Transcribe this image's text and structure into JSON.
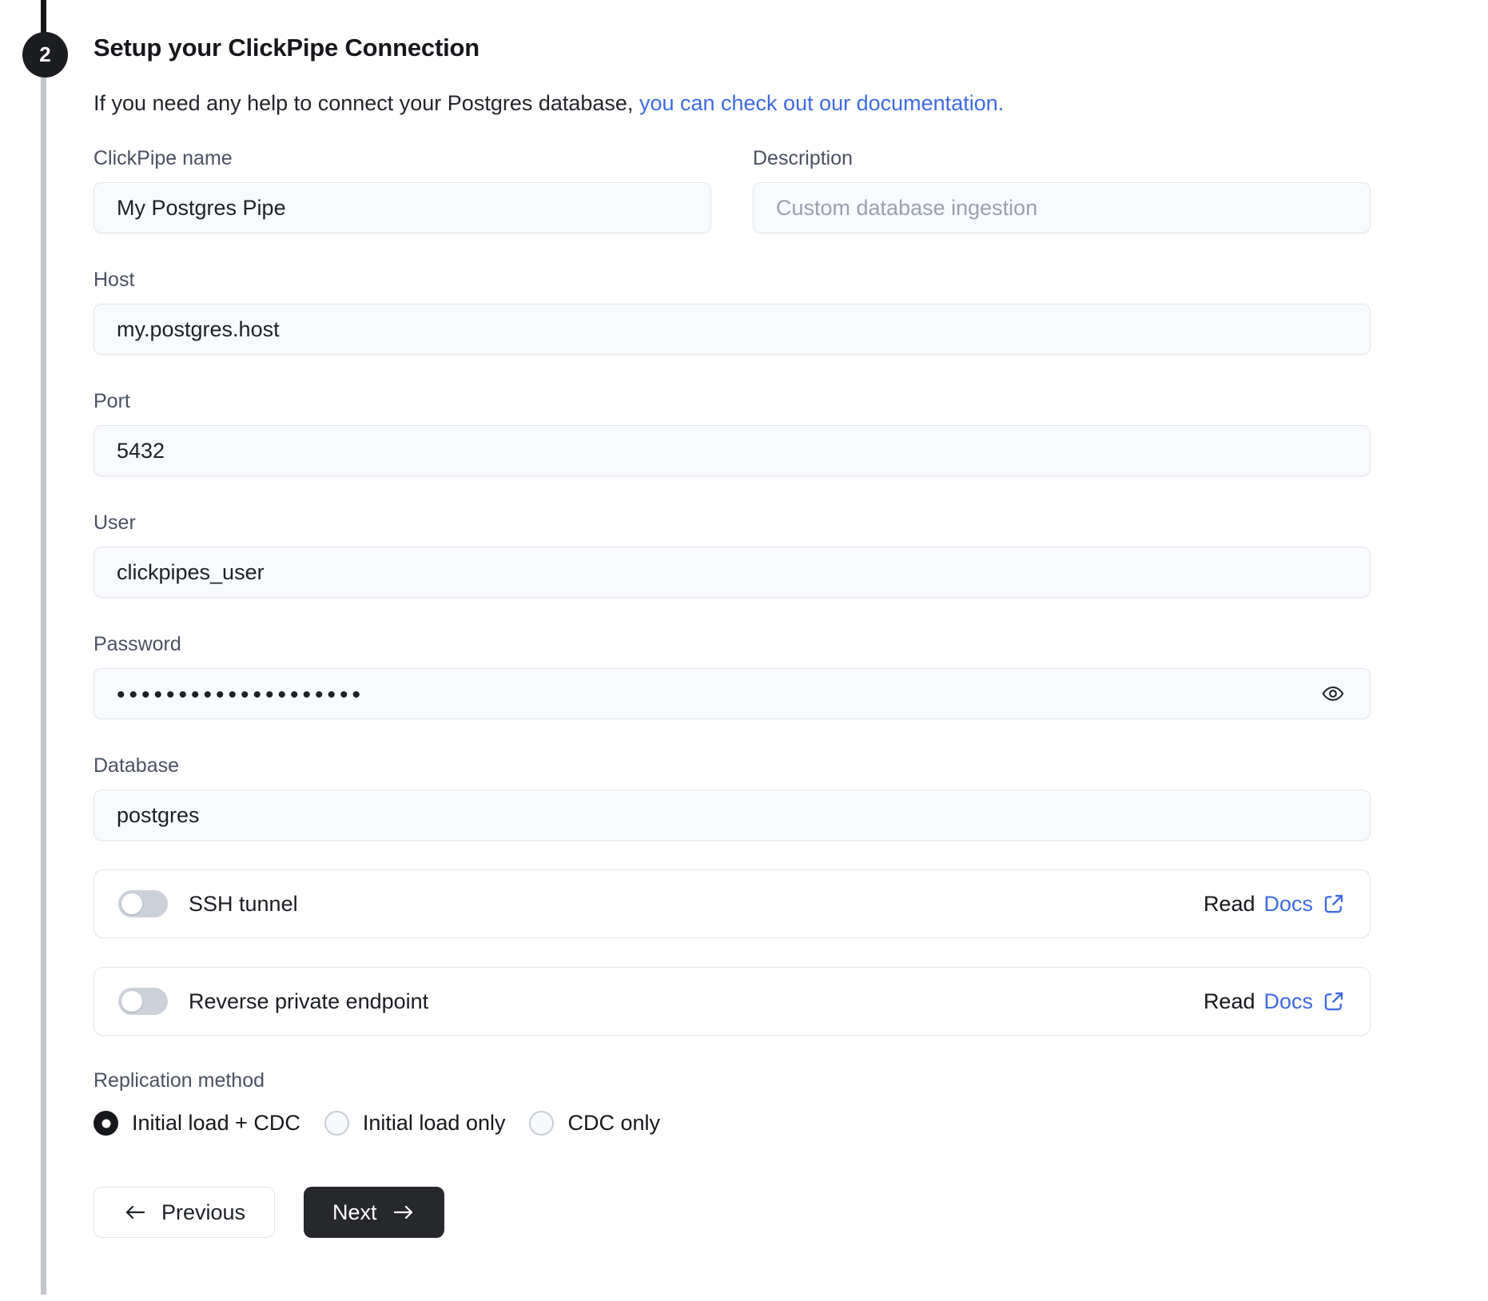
{
  "step": {
    "number": "2"
  },
  "header": {
    "title": "Setup your ClickPipe Connection",
    "subtitle_prefix": "If you need any help to connect your Postgres database, ",
    "subtitle_link": "you can check out our documentation."
  },
  "form": {
    "fields": {
      "clickpipe_name": {
        "label": "ClickPipe name",
        "value": "My Postgres Pipe"
      },
      "description": {
        "label": "Description",
        "placeholder": "Custom database ingestion"
      },
      "host": {
        "label": "Host",
        "value": "my.postgres.host"
      },
      "port": {
        "label": "Port",
        "value": "5432"
      },
      "user": {
        "label": "User",
        "value": "clickpipes_user"
      },
      "password": {
        "label": "Password",
        "value": "••••••••••••••••••••"
      },
      "database": {
        "label": "Database",
        "value": "postgres"
      }
    },
    "toggles": [
      {
        "label": "SSH tunnel",
        "state": "off",
        "read_text": "Read",
        "docs_text": "Docs"
      },
      {
        "label": "Reverse private endpoint",
        "state": "off",
        "read_text": "Read",
        "docs_text": "Docs"
      }
    ],
    "replication": {
      "label": "Replication method",
      "options": [
        {
          "label": "Initial load + CDC",
          "selected": true
        },
        {
          "label": "Initial load only",
          "selected": false
        },
        {
          "label": "CDC only",
          "selected": false
        }
      ]
    },
    "buttons": {
      "previous": "Previous",
      "next": "Next"
    }
  },
  "colors": {
    "link_blue": "#3e6be0",
    "step_circle": "#1b1d20",
    "next_button_bg": "#26282c",
    "toggle_off": "#ccd1d9",
    "input_bg": "#f8fafd"
  }
}
